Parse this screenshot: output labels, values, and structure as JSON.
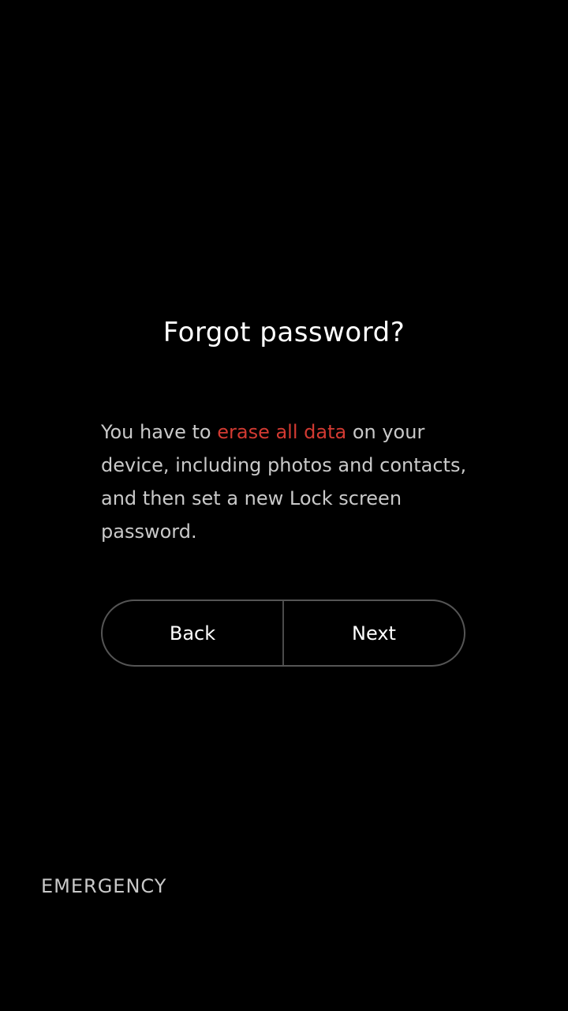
{
  "dialog": {
    "title": "Forgot password?",
    "message_before": "You have to ",
    "message_highlight": "erase all data",
    "message_after": " on your device, including photos and contacts, and then set a new Lock screen password.",
    "back_label": "Back",
    "next_label": "Next"
  },
  "footer": {
    "emergency_label": "EMERGENCY"
  },
  "colors": {
    "background": "#000000",
    "highlight": "#d23a32",
    "body_text": "#c9c9c9",
    "button_border": "#555555"
  }
}
